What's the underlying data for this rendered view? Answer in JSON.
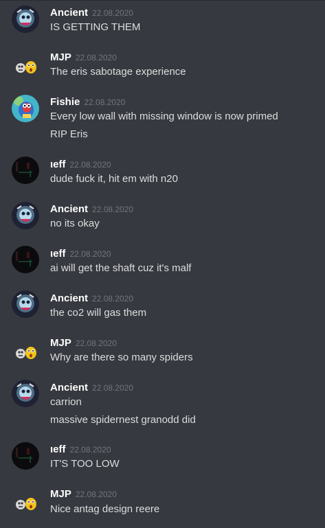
{
  "messages": [
    {
      "author": "Ancient",
      "time": "22.08.2020",
      "avatar": "ancient-avatar",
      "lines": [
        "IS GETTING THEM"
      ]
    },
    {
      "author": "MJP",
      "time": "22.08.2020",
      "avatar": "mjp-avatar",
      "lines": [
        "The eris sabotage experience"
      ]
    },
    {
      "author": "Fishie",
      "time": "22.08.2020",
      "avatar": "fishie-avatar",
      "lines": [
        "Every low wall with missing window is now primed",
        "RIP Eris"
      ]
    },
    {
      "author": "ιeff",
      "time": "22.08.2020",
      "avatar": "leff-avatar",
      "lines": [
        "dude fuck it, hit em with n20"
      ]
    },
    {
      "author": "Ancient",
      "time": "22.08.2020",
      "avatar": "ancient-avatar",
      "lines": [
        "no its okay"
      ]
    },
    {
      "author": "ιeff",
      "time": "22.08.2020",
      "avatar": "leff-avatar",
      "lines": [
        "ai will get the shaft cuz it's malf"
      ]
    },
    {
      "author": "Ancient",
      "time": "22.08.2020",
      "avatar": "ancient-avatar",
      "lines": [
        "the co2 will gas them"
      ]
    },
    {
      "author": "MJP",
      "time": "22.08.2020",
      "avatar": "mjp-avatar",
      "lines": [
        "Why are there so many spiders"
      ]
    },
    {
      "author": "Ancient",
      "time": "22.08.2020",
      "avatar": "ancient-avatar",
      "lines": [
        "carrion",
        "massive spidernest granodd did"
      ]
    },
    {
      "author": "ιeff",
      "time": "22.08.2020",
      "avatar": "leff-avatar",
      "lines": [
        "IT'S TOO LOW"
      ]
    },
    {
      "author": "MJP",
      "time": "22.08.2020",
      "avatar": "mjp-avatar",
      "lines": [
        "Nice antag design reere"
      ]
    }
  ],
  "colors": {
    "background": "#36393f",
    "author": "#ffffff",
    "timestamp": "#72767d",
    "text": "#dcddde"
  }
}
